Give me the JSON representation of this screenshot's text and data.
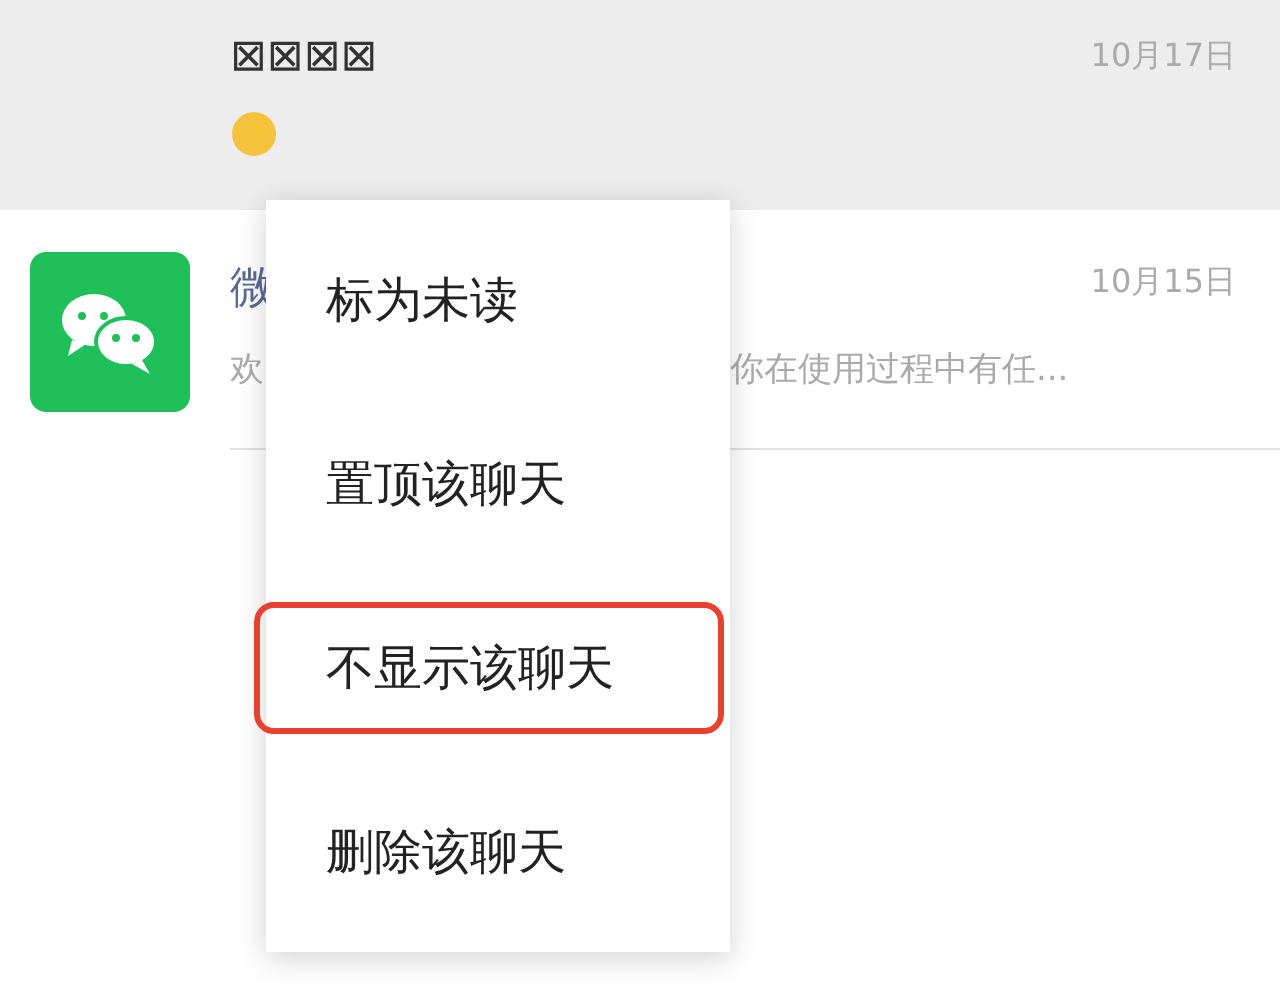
{
  "chats": [
    {
      "kind": "pinned",
      "name": "⊠⊠⊠⊠",
      "time": "10月17日"
    },
    {
      "kind": "normal",
      "name": "微",
      "time": "10月15日",
      "preview_start": "欢",
      "preview_end": "你在使用过程中有任..."
    }
  ],
  "context_menu": {
    "items": [
      {
        "label": "标为未读",
        "highlighted": false
      },
      {
        "label": "置顶该聊天",
        "highlighted": false
      },
      {
        "label": "不显示该聊天",
        "highlighted": true
      },
      {
        "label": "删除该聊天",
        "highlighted": false
      }
    ]
  }
}
